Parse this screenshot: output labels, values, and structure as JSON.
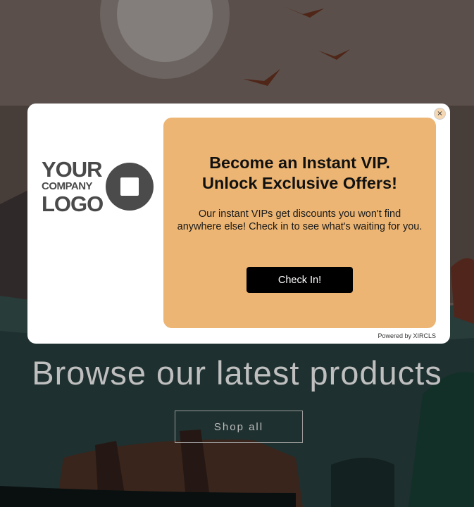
{
  "hero": {
    "title": "Browse our latest products",
    "shop_label": "Shop all"
  },
  "popup": {
    "logo": {
      "line1": "YOUR",
      "line2": "COMPANY",
      "line3": "LOGO"
    },
    "headline_line1": "Become an Instant VIP.",
    "headline_line2": "Unlock Exclusive Offers!",
    "subtext": "Our instant VIPs get discounts you won't find anywhere else! Check in to see what's waiting for you.",
    "cta_label": "Check In!",
    "close_symbol": "×",
    "powered_by": "Powered by XIRCLS",
    "accent_color": "#ecb573"
  }
}
